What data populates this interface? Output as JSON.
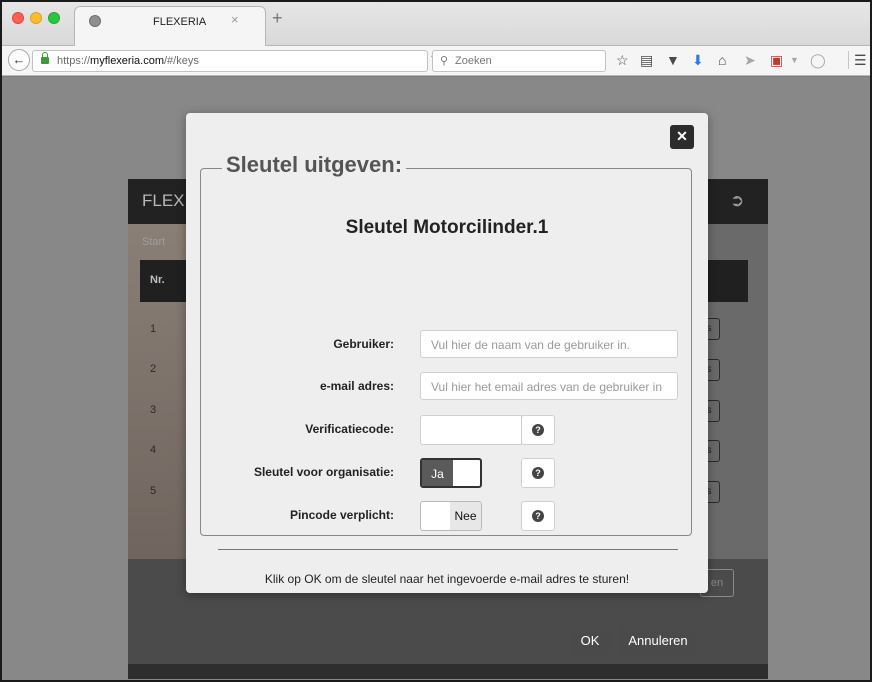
{
  "browser": {
    "tab_title": "FLEXERIA",
    "tab_close": "×",
    "new_tab": "+",
    "url_scheme": "https://",
    "url_domain": "myflexeria.com",
    "url_path": "/#/keys",
    "search_placeholder": "Zoeken",
    "icons": [
      "back-arrow-icon",
      "lock-icon",
      "reload-icon",
      "search-icon",
      "bookmark-star-icon",
      "reading-list-icon",
      "pocket-icon",
      "downloads-icon",
      "home-icon",
      "send-icon",
      "extension-icon",
      "dropdown-icon",
      "chat-icon",
      "menu-icon"
    ]
  },
  "app": {
    "logo": "FLEX",
    "start_tab": "Start",
    "table": {
      "col_nr": "Nr.",
      "col_right": "s",
      "rows": [
        "1",
        "2",
        "3",
        "4",
        "5"
      ],
      "row_button": "s"
    },
    "footer_button": "en"
  },
  "modal": {
    "legend": "Sleutel uitgeven:",
    "subtitle": "Sleutel Motorcilinder.1",
    "fields": {
      "gebruiker": {
        "label": "Gebruiker:",
        "placeholder": "Vul hier de naam van de gebruiker in."
      },
      "email": {
        "label": "e-mail adres:",
        "placeholder": "Vul hier het email adres van de gebruiker in"
      },
      "verificatie": {
        "label": "Verificatiecode:",
        "value": ""
      },
      "organisatie": {
        "label": "Sleutel voor organisatie:",
        "state": "Ja"
      },
      "pincode": {
        "label": "Pincode verplicht:",
        "state": "Nee"
      }
    },
    "help_glyph": "?",
    "note": "Klik op OK om de sleutel naar het ingevoerde e-mail adres te sturen!",
    "ok_label": "OK",
    "cancel_label": "Annuleren"
  }
}
